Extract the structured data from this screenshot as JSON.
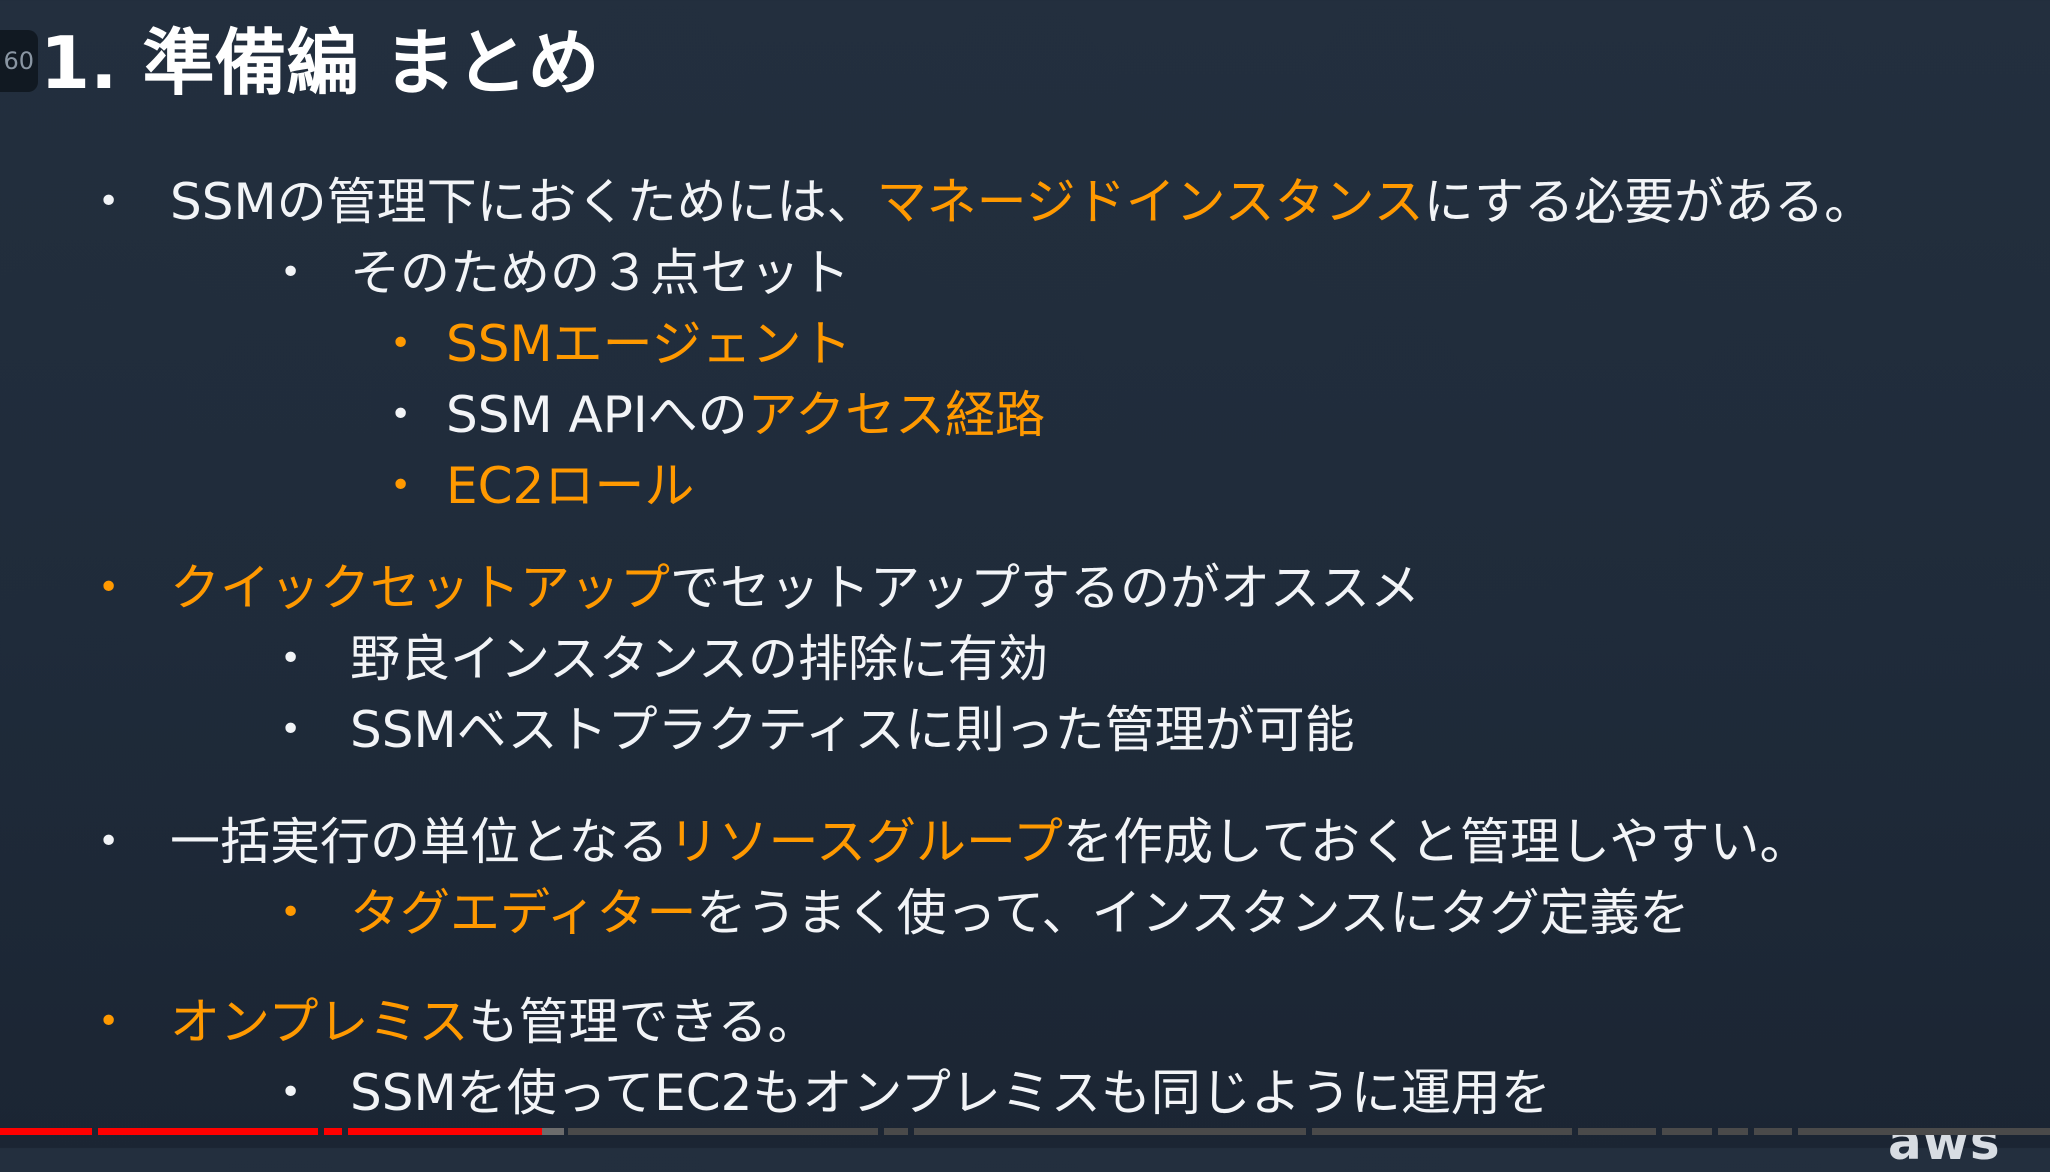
{
  "player": {
    "time_badge": "60"
  },
  "slide": {
    "title": "1. 準備編 まとめ",
    "section1": {
      "text_a": "SSMの管理下におくためには、",
      "highlight": "マネージドインスタンス",
      "text_b": "にする必要がある。",
      "sub_title": "そのための３点セット",
      "item1": "SSMエージェント",
      "item2_a": "SSM APIへの",
      "item2_b": "アクセス経路",
      "item3": "EC2ロール"
    },
    "section2": {
      "highlight": "クイックセットアップ",
      "text": "でセットアップするのがオススメ",
      "sub1": "野良インスタンスの排除に有効",
      "sub2": "SSMベストプラクティスに則った管理が可能"
    },
    "section3": {
      "text_a": "一括実行の単位となる",
      "highlight": "リソースグループ",
      "text_b": "を作成しておくと管理しやすい。",
      "sub_highlight": "タグエディター",
      "sub_text": "をうまく使って、インスタンスにタグ定義を"
    },
    "section4": {
      "highlight": "オンプレミス",
      "text": "も管理できる。",
      "sub": "SSMを使ってEC2もオンプレミスも同じように運用を"
    },
    "logo": "aws",
    "bullet": "•"
  },
  "progress": {
    "played_fraction": 0.27,
    "colors": {
      "played": "#ff0000",
      "buffered": "#6c6c6c",
      "unplayed": "#4a4a4a"
    }
  },
  "colors": {
    "background": "#232f3e",
    "text": "#f2f4f7",
    "accent": "#ff9900"
  }
}
